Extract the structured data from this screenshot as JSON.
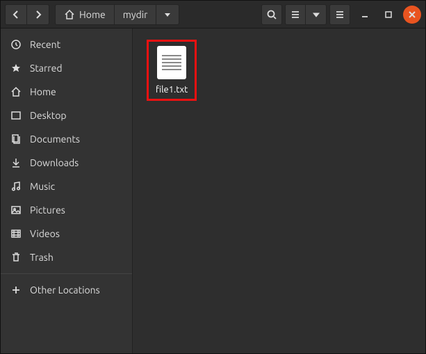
{
  "path": {
    "home_label": "Home",
    "current_dir": "mydir"
  },
  "sidebar": {
    "items": [
      {
        "label": "Recent"
      },
      {
        "label": "Starred"
      },
      {
        "label": "Home"
      },
      {
        "label": "Desktop"
      },
      {
        "label": "Documents"
      },
      {
        "label": "Downloads"
      },
      {
        "label": "Music"
      },
      {
        "label": "Pictures"
      },
      {
        "label": "Videos"
      },
      {
        "label": "Trash"
      }
    ],
    "other_locations": "Other Locations"
  },
  "files": [
    {
      "name": "file1.txt",
      "selected": true
    }
  ],
  "colors": {
    "accent": "#e95420",
    "selection": "#e11"
  }
}
